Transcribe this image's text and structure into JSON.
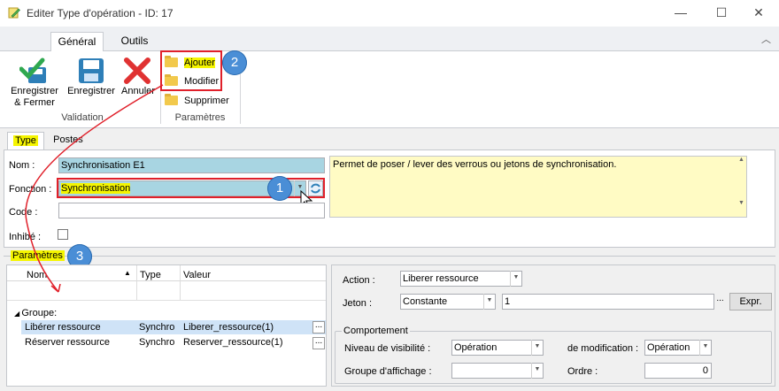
{
  "window": {
    "title": "Editer Type d'opération - ID: 17",
    "minimize": "—",
    "maximize": "☐",
    "close": "✕"
  },
  "ribbon_tabs": [
    "Général",
    "Outils"
  ],
  "ribbon": {
    "save_close": "Enregistrer\n& Fermer",
    "save": "Enregistrer",
    "cancel": "Annuler",
    "group_validation": "Validation",
    "add": "Ajouter",
    "modify": "Modifier",
    "delete": "Supprimer",
    "group_params": "Paramètres"
  },
  "form_tabs": [
    "Type",
    "Postes"
  ],
  "form": {
    "nom_label": "Nom :",
    "nom_value": "Synchronisation E1",
    "fonction_label": "Fonction :",
    "fonction_value": "Synchronisation",
    "code_label": "Code :",
    "code_value": "",
    "inhibe_label": "Inhibé :",
    "description": "Permet de poser / lever des verrous ou jetons de synchronisation."
  },
  "params": {
    "section_label": "Paramètres",
    "columns": [
      "Nom",
      "Type",
      "Valeur"
    ],
    "group_label": "Groupe:",
    "rows": [
      {
        "nom": "Libérer ressource",
        "type": "Synchro",
        "valeur": "Liberer_ressource(1)"
      },
      {
        "nom": "Réserver ressource",
        "type": "Synchro",
        "valeur": "Reserver_ressource(1)"
      }
    ]
  },
  "detail": {
    "action_label": "Action :",
    "action_value": "Liberer ressource",
    "jeton_label": "Jeton :",
    "jeton_type": "Constante",
    "jeton_value": "1",
    "expr_label": "Expr.",
    "comportement_label": "Comportement",
    "visibilite_label": "Niveau de visibilité :",
    "visibilite_value": "Opération",
    "modification_label": "de modification :",
    "modification_value": "Opération",
    "groupe_label": "Groupe d'affichage :",
    "groupe_value": "",
    "ordre_label": "Ordre :",
    "ordre_value": "0"
  },
  "annotations": [
    "1",
    "2",
    "3"
  ],
  "icons": {
    "app": "pencil-notepad-icon",
    "save_close": "checkmark-save-icon",
    "save": "floppy-disk-icon",
    "cancel": "red-x-icon",
    "add": "folder-add-icon",
    "modify": "folder-edit-icon",
    "delete": "folder-delete-icon",
    "refresh": "refresh-icon",
    "collapse": "chevron-up-icon"
  },
  "colors": {
    "field_highlight": "#a8d5e2",
    "description_bg": "#fffbc4",
    "badge": "#4a8ed6",
    "annotation_red": "#e0202a",
    "yellow_highlight": "#f5f500",
    "row_selected": "#cfe3f7"
  }
}
